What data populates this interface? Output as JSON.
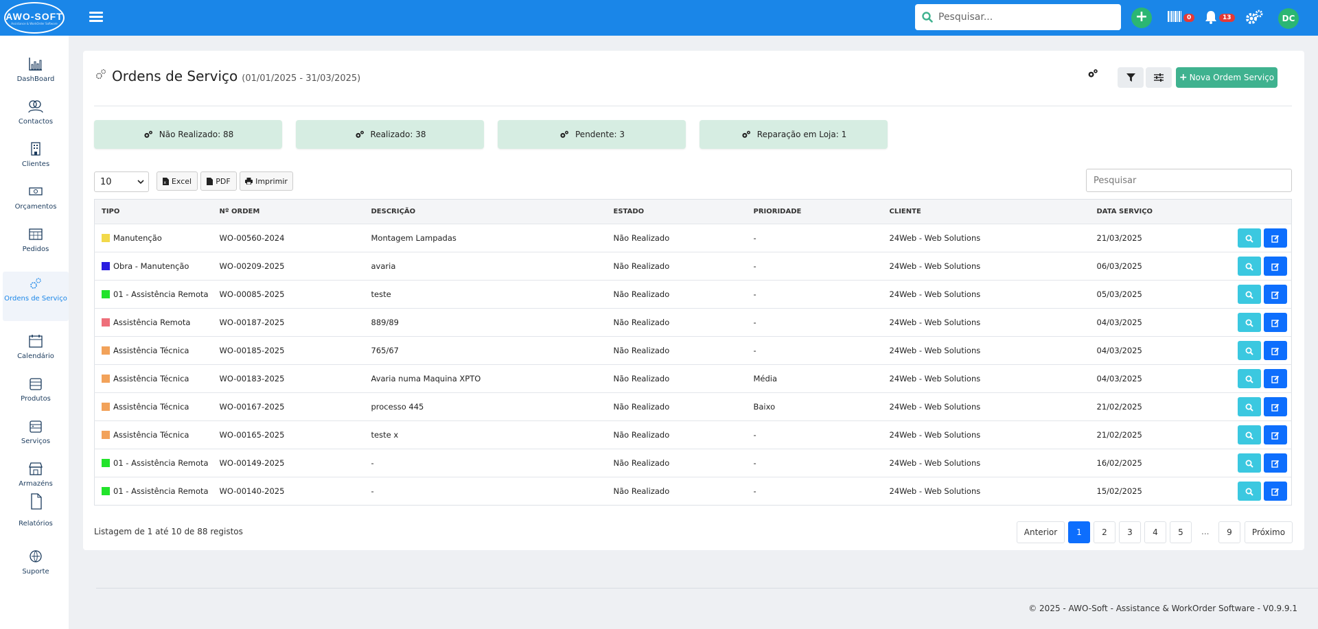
{
  "header": {
    "logo_text": "AWO-SOFT",
    "logo_sub": "Assistance & WorkOrder Software",
    "search_placeholder": "Pesquisar...",
    "barcode_count": "0",
    "notifications_count": "13",
    "avatar_initials": "DC"
  },
  "sidebar": {
    "items": [
      {
        "label": "DashBoard",
        "icon": "chart-icon"
      },
      {
        "label": "Contactos",
        "icon": "contacts-icon"
      },
      {
        "label": "Clientes",
        "icon": "building-icon"
      },
      {
        "label": "Orçamentos",
        "icon": "money-icon"
      },
      {
        "label": "Pedidos",
        "icon": "calendar-grid-icon"
      },
      {
        "label": "Ordens de Serviço",
        "icon": "gears-icon"
      },
      {
        "label": "Calendário",
        "icon": "calendar-icon"
      },
      {
        "label": "Produtos",
        "icon": "box-icon"
      },
      {
        "label": "Serviços",
        "icon": "services-icon"
      },
      {
        "label": "Armazéns",
        "icon": "warehouse-icon"
      },
      {
        "label": "Relatórios",
        "icon": "report-icon"
      },
      {
        "label": "Suporte",
        "icon": "support-icon"
      }
    ]
  },
  "page": {
    "title": "Ordens de Serviço",
    "date_range": "(01/01/2025 - 31/03/2025)",
    "new_button": "Nova Ordem Serviço"
  },
  "stats": [
    {
      "label": "Não Realizado: 88"
    },
    {
      "label": "Realizado: 38"
    },
    {
      "label": "Pendente: 3"
    },
    {
      "label": "Reparação em Loja: 1"
    }
  ],
  "toolbar": {
    "page_size": "10",
    "excel": "Excel",
    "pdf": "PDF",
    "print": "Imprimir",
    "search_placeholder": "Pesquisar"
  },
  "table": {
    "columns": [
      "TIPO",
      "Nº ORDEM",
      "DESCRIÇÃO",
      "ESTADO",
      "PRIORIDADE",
      "CLIENTE",
      "DATA SERVIÇO"
    ],
    "rows": [
      {
        "color": "#f2d94a",
        "tipo": "Manutenção",
        "ordem": "WO-00560-2024",
        "descricao": "Montagem Lampadas",
        "estado": "Não Realizado",
        "prioridade": "-",
        "cliente": "24Web - Web Solutions",
        "data": "21/03/2025"
      },
      {
        "color": "#2a1de0",
        "tipo": "Obra - Manutenção",
        "ordem": "WO-00209-2025",
        "descricao": "avaria",
        "estado": "Não Realizado",
        "prioridade": "-",
        "cliente": "24Web - Web Solutions",
        "data": "06/03/2025"
      },
      {
        "color": "#22e32b",
        "tipo": "01 - Assistência Remota",
        "ordem": "WO-00085-2025",
        "descricao": "teste",
        "estado": "Não Realizado",
        "prioridade": "-",
        "cliente": "24Web - Web Solutions",
        "data": "05/03/2025"
      },
      {
        "color": "#ee6f7a",
        "tipo": "Assistência Remota",
        "ordem": "WO-00187-2025",
        "descricao": "889/89",
        "estado": "Não Realizado",
        "prioridade": "-",
        "cliente": "24Web - Web Solutions",
        "data": "04/03/2025"
      },
      {
        "color": "#f2a25a",
        "tipo": "Assistência Técnica",
        "ordem": "WO-00185-2025",
        "descricao": "765/67",
        "estado": "Não Realizado",
        "prioridade": "-",
        "cliente": "24Web - Web Solutions",
        "data": "04/03/2025"
      },
      {
        "color": "#f2a25a",
        "tipo": "Assistência Técnica",
        "ordem": "WO-00183-2025",
        "descricao": "Avaria numa Maquina XPTO",
        "estado": "Não Realizado",
        "prioridade": "Média",
        "cliente": "24Web - Web Solutions",
        "data": "04/03/2025"
      },
      {
        "color": "#f2a25a",
        "tipo": "Assistência Técnica",
        "ordem": "WO-00167-2025",
        "descricao": "processo 445",
        "estado": "Não Realizado",
        "prioridade": "Baixo",
        "cliente": "24Web - Web Solutions",
        "data": "21/02/2025"
      },
      {
        "color": "#f2a25a",
        "tipo": "Assistência Técnica",
        "ordem": "WO-00165-2025",
        "descricao": "teste x",
        "estado": "Não Realizado",
        "prioridade": "-",
        "cliente": "24Web - Web Solutions",
        "data": "21/02/2025"
      },
      {
        "color": "#22e32b",
        "tipo": "01 - Assistência Remota",
        "ordem": "WO-00149-2025",
        "descricao": "-",
        "estado": "Não Realizado",
        "prioridade": "-",
        "cliente": "24Web - Web Solutions",
        "data": "16/02/2025"
      },
      {
        "color": "#22e32b",
        "tipo": "01 - Assistência Remota",
        "ordem": "WO-00140-2025",
        "descricao": "-",
        "estado": "Não Realizado",
        "prioridade": "-",
        "cliente": "24Web - Web Solutions",
        "data": "15/02/2025"
      }
    ]
  },
  "pagination": {
    "summary": "Listagem de 1 até 10 de 88 registos",
    "previous": "Anterior",
    "pages": [
      "1",
      "2",
      "3",
      "4",
      "5"
    ],
    "ellipsis": "...",
    "last": "9",
    "next": "Próximo"
  },
  "footer": {
    "text": "© 2025 - AWO-Soft - Assistance & WorkOrder Software - V0.9.9.1"
  },
  "colors": {
    "topbar": "#1a86e8",
    "primary": "#0d6efd",
    "success": "#3fb28f",
    "stat_bg": "#d6ede2"
  }
}
